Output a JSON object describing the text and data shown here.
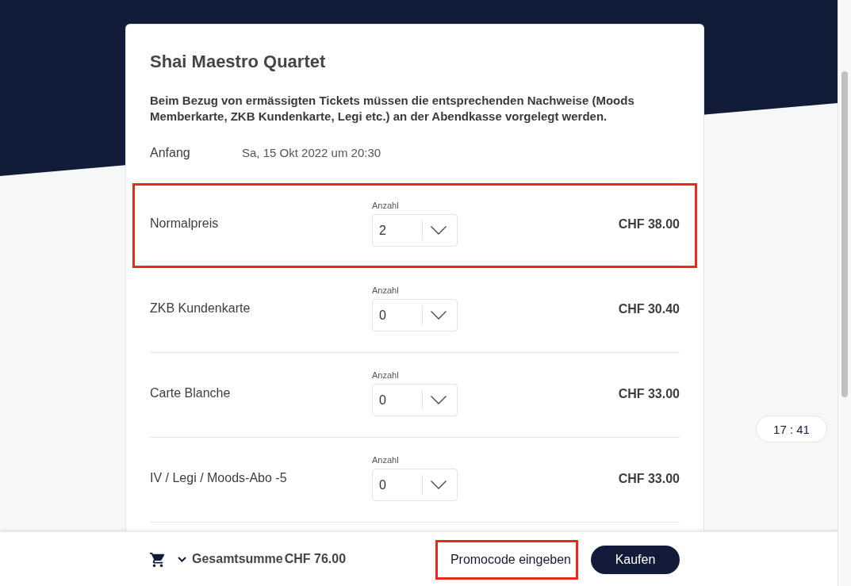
{
  "event": {
    "title": "Shai Maestro Quartet",
    "notice": "Beim Bezug von ermässigten Tickets müssen die entsprechenden Nachweise (Moods Memberkarte, ZKB Kundenkarte, Legi etc.) an der Abendkasse vorgelegt werden.",
    "start": {
      "label": "Anfang",
      "value": "Sa, 15 Okt 2022 um 20:30"
    }
  },
  "tickets": [
    {
      "name": "Normalpreis",
      "quantity_label": "Anzahl",
      "quantity": "2",
      "price": "CHF 38.00",
      "highlighted": true
    },
    {
      "name": "ZKB Kundenkarte",
      "quantity_label": "Anzahl",
      "quantity": "0",
      "price": "CHF 30.40",
      "highlighted": false
    },
    {
      "name": "Carte Blanche",
      "quantity_label": "Anzahl",
      "quantity": "0",
      "price": "CHF 33.00",
      "highlighted": false
    },
    {
      "name": "IV / Legi / Moods-Abo -5",
      "quantity_label": "Anzahl",
      "quantity": "0",
      "price": "CHF 33.00",
      "highlighted": false
    }
  ],
  "timer": "17 : 41",
  "footer": {
    "total_label": "Gesamtsumme",
    "total": "CHF 76.00",
    "promo_button": {
      "label": "Promocode eingeben",
      "highlighted": true
    },
    "buy_button": "Kaufen"
  }
}
